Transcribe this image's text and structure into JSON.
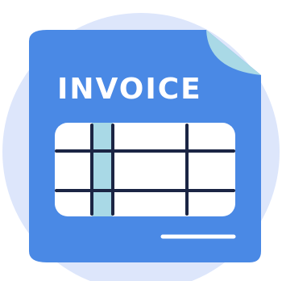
{
  "icon": {
    "name": "invoice-document-icon",
    "title": "INVOICE",
    "colors": {
      "background_circle": "#dde6fb",
      "document": "#4a89e5",
      "folded_corner": "#a9d9e6",
      "table_background": "#ffffff",
      "table_lines": "#1b2544",
      "highlighted_column": "#a9d9e6",
      "footer_line": "#ffffff"
    }
  }
}
